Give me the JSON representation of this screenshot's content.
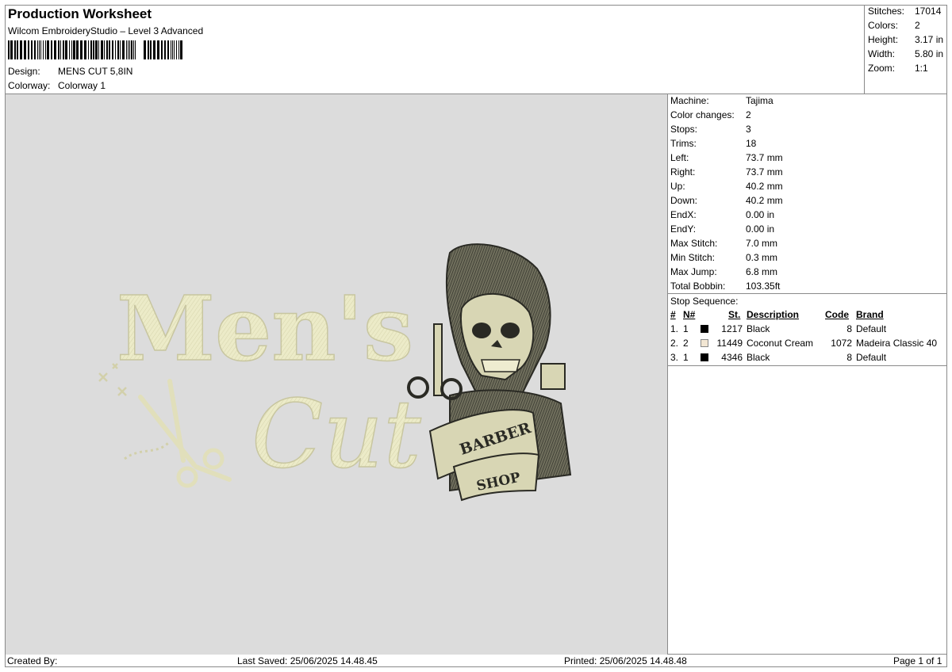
{
  "header": {
    "title": "Production Worksheet",
    "subtitle": "Wilcom EmbroideryStudio – Level 3 Advanced",
    "design_label": "Design:",
    "design_value": "MENS CUT 5,8IN",
    "colorway_label": "Colorway:",
    "colorway_value": "Colorway 1"
  },
  "summary": {
    "stitches_label": "Stitches:",
    "stitches_value": "17014",
    "colors_label": "Colors:",
    "colors_value": "2",
    "height_label": "Height:",
    "height_value": "3.17 in",
    "width_label": "Width:",
    "width_value": "5.80 in",
    "zoom_label": "Zoom:",
    "zoom_value": "1:1"
  },
  "design_preview": {
    "line1": "Men's",
    "line2": "Cut",
    "banner_top": "BARBER",
    "banner_bottom": "SHOP"
  },
  "properties": [
    {
      "label": "Machine:",
      "value": "Tajima"
    },
    {
      "label": "Color changes:",
      "value": "2"
    },
    {
      "label": "Stops:",
      "value": "3"
    },
    {
      "label": "Trims:",
      "value": "18"
    },
    {
      "label": "Left:",
      "value": "73.7 mm"
    },
    {
      "label": "Right:",
      "value": "73.7 mm"
    },
    {
      "label": "Up:",
      "value": "40.2 mm"
    },
    {
      "label": "Down:",
      "value": "40.2 mm"
    },
    {
      "label": "EndX:",
      "value": "0.00 in"
    },
    {
      "label": "EndY:",
      "value": "0.00 in"
    },
    {
      "label": "Max Stitch:",
      "value": "7.0 mm"
    },
    {
      "label": "Min Stitch:",
      "value": "0.3 mm"
    },
    {
      "label": "Max Jump:",
      "value": "6.8 mm"
    },
    {
      "label": "Total Bobbin:",
      "value": "103.35ft"
    }
  ],
  "stop_sequence": {
    "title": "Stop Sequence:",
    "headers": {
      "num": "#",
      "n": "N#",
      "st": "St.",
      "description": "Description",
      "code": "Code",
      "brand": "Brand"
    },
    "rows": [
      {
        "num": "1.",
        "n": "1",
        "color": "#000000",
        "st": "1217",
        "description": "Black",
        "code": "8",
        "brand": "Default"
      },
      {
        "num": "2.",
        "n": "2",
        "color": "#f2e6d3",
        "st": "11449",
        "description": "Coconut Cream",
        "code": "1072",
        "brand": "Madeira Classic 40"
      },
      {
        "num": "3.",
        "n": "1",
        "color": "#000000",
        "st": "4346",
        "description": "Black",
        "code": "8",
        "brand": "Default"
      }
    ]
  },
  "footer": {
    "created_by": "Created By:",
    "last_saved": "Last Saved: 25/06/2025 14.48.45",
    "printed": "Printed: 25/06/2025 14.48.48",
    "page": "Page 1 of 1"
  },
  "colors": {
    "canvas_bg": "#dcdcdc",
    "thread_cream": "#ecebc8",
    "thread_black": "#2a2a24",
    "border": "#8a8a8a"
  }
}
